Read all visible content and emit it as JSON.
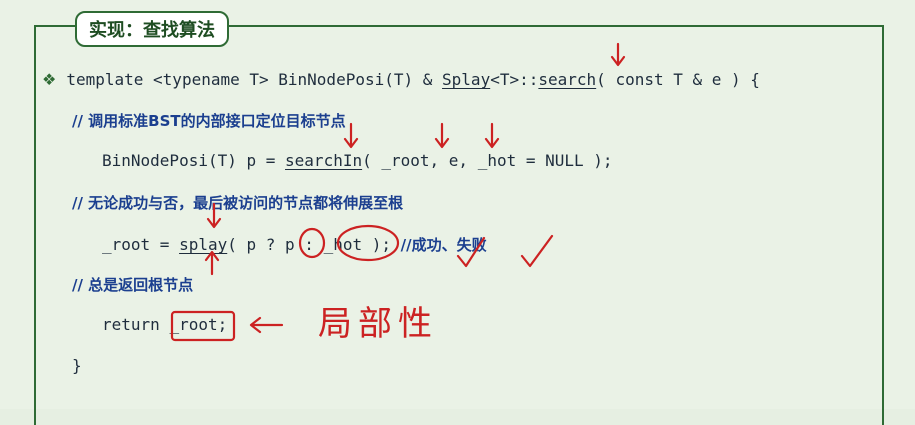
{
  "title": "实现：查找算法",
  "code": {
    "bullet": "❖",
    "l1": {
      "pre": "template <typename T> BinNodePosi(T) & ",
      "splay": "Splay",
      "mid": "<T>::",
      "search": "search",
      "post": "( const T & e ) {"
    },
    "c1": "// 调用标准BST的内部接口定位目标节点",
    "l2": {
      "pre": "BinNodePosi(T) p = ",
      "searchIn": "searchIn",
      "post": "( _root, e, _hot = NULL );"
    },
    "c2": "// 无论成功与否，最后被访问的节点都将伸展至根",
    "l3": {
      "pre": "_root = ",
      "splay": "splay",
      "open": "( p ? ",
      "p": "p",
      "colon": " : ",
      "hot": "_hot",
      "close": " ); ",
      "cmt": "//成功、失败"
    },
    "c3": "// 总是返回根节点",
    "l4": {
      "pre": "return ",
      "root": "_root",
      "semi": ";"
    },
    "l5": "}"
  },
  "annotation": "局部性",
  "colors": {
    "frame": "#2f6b35",
    "ink": "#cc2222",
    "comment": "#1b3f8f"
  }
}
